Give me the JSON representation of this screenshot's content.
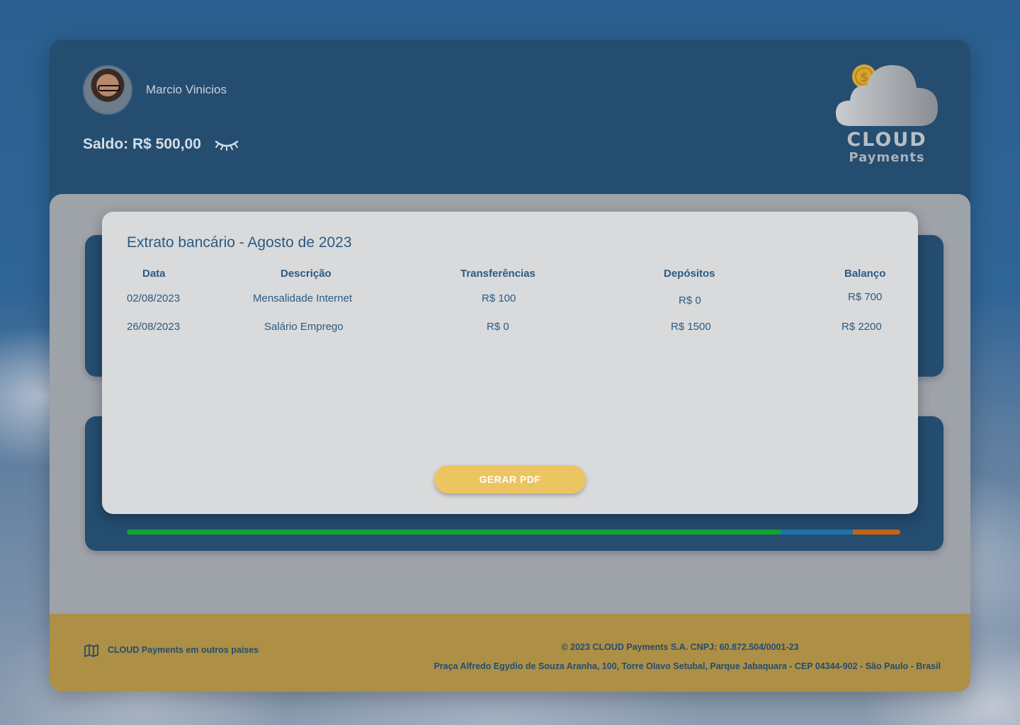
{
  "header": {
    "user_name": "Marcio Vinicios",
    "balance_label": "Saldo: R$ 500,00",
    "logo": {
      "word1": "CLOUD",
      "word2": "Payments"
    }
  },
  "statement": {
    "title": "Extrato bancário - Agosto de 2023",
    "columns": [
      "Data",
      "Descrição",
      "Transferências",
      "Depósitos",
      "Balanço"
    ],
    "rows": [
      [
        "02/08/2023",
        "Mensalidade Internet",
        "R$ 100",
        "R$ 0",
        "R$ 700"
      ],
      [
        "26/08/2023",
        "Salário Emprego",
        "R$ 0",
        "R$ 1500",
        "R$ 2200"
      ]
    ],
    "pdf_button": "GERAR PDF"
  },
  "progress": {
    "segments": [
      {
        "fraction": 0.845,
        "color": "#12a42e"
      },
      {
        "fraction": 0.094,
        "color": "#1f73a8"
      },
      {
        "fraction": 0.061,
        "color": "#c76414"
      }
    ]
  },
  "footer": {
    "countries_link": "CLOUD Payments em outros países",
    "copyright": "© 2023 CLOUD Payments S.A. CNPJ: 60.872.504/0001-23",
    "address": "Praça Alfredo Egydio de Souza Aranha, 100, Torre Olavo Setubal, Parque Jabaquara - CEP 04344-902 - São Paulo - Brasil"
  },
  "colors": {
    "header_bg": "#244d70",
    "accent_yellow": "#ecc461",
    "footer_bg": "#ad8f46",
    "text_blue": "#2c5a84"
  }
}
